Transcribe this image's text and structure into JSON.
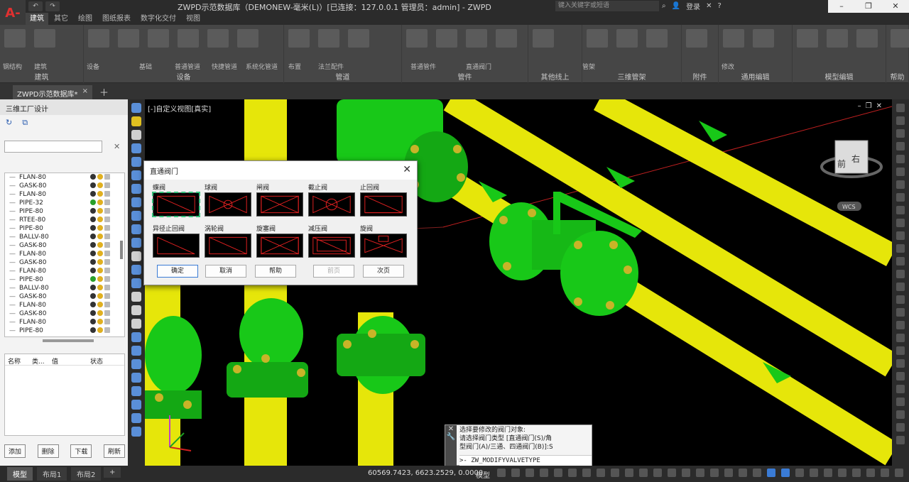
{
  "app": {
    "title": "ZWPD示范数据库（DEMONEW-毫米(L)）[已连接：127.0.0.1 管理员：admin] - ZWPD",
    "logo": "A-",
    "search_placeholder": "键入关键字或短语",
    "login": "登录"
  },
  "ribbon_tabs": [
    "建筑",
    "其它",
    "绘图",
    "图纸报表",
    "数字化交付",
    "视图"
  ],
  "ribbon_tab_active": 0,
  "ribbon_groups": [
    "建筑",
    "设备",
    "管道",
    "管件",
    "其他线上",
    "三维管架",
    "附件",
    "通用编辑",
    "模型编辑",
    "帮助"
  ],
  "ribbon_buttons": [
    "钢结构",
    "建筑",
    "设备",
    "基础",
    "普通管道",
    "快捷管道",
    "系统化管道",
    "布置",
    "法兰配件",
    "普通管件",
    "直通阀门",
    "管架",
    "修改"
  ],
  "document": {
    "tab_label": "ZWPD示范数据库*"
  },
  "left_panel": {
    "title": "三维工厂设计",
    "tree_items": [
      "FLAN-80",
      "GASK-80",
      "FLAN-80",
      "PIPE-32",
      "PIPE-80",
      "RTEE-80",
      "PIPE-80",
      "BALLV-80",
      "GASK-80",
      "FLAN-80",
      "GASK-80",
      "FLAN-80",
      "PIPE-80",
      "BALLV-80",
      "GASK-80",
      "FLAN-80",
      "GASK-80",
      "FLAN-80",
      "PIPE-80"
    ],
    "props_headers": [
      "名称",
      "类...",
      "值",
      "状态"
    ],
    "buttons": [
      "添加",
      "删除",
      "下载",
      "刷新"
    ]
  },
  "viewport": {
    "label": "[-]自定义视图[真实]",
    "cube_face": "右",
    "cube_face2": "前",
    "wcs": "WCS"
  },
  "dialog": {
    "title": "直通阀门",
    "valves": [
      {
        "label": "蝶阀",
        "selected": true
      },
      {
        "label": "球阀",
        "selected": false
      },
      {
        "label": "闸阀",
        "selected": false
      },
      {
        "label": "截止阀",
        "selected": false
      },
      {
        "label": "止回阀",
        "selected": false
      },
      {
        "label": "异径止回阀",
        "selected": false
      },
      {
        "label": "涡轮阀",
        "selected": false
      },
      {
        "label": "旋塞阀",
        "selected": false
      },
      {
        "label": "减压阀",
        "selected": false
      },
      {
        "label": "旋阀",
        "selected": false
      }
    ],
    "buttons": {
      "ok": "确定",
      "cancel": "取消",
      "help": "帮助",
      "prev": "前页",
      "next": "次页"
    }
  },
  "command": {
    "lines": [
      "选择要修改的阀门对象:",
      "请选择阀门类型 [直通阀门(S)/角",
      "型阀门(A)/三通、四通阀门(B)]:S"
    ],
    "input": "ZW_MODIFYVALVETYPE"
  },
  "status": {
    "tabs": [
      "模型",
      "布局1",
      "布局2"
    ],
    "coords": "60569.7423, 6623.2529, 0.0000",
    "model_label": "模型"
  },
  "colors": {
    "pipe_yellow": "#e6e60a",
    "valve_green": "#18c818",
    "bolt_gold": "#c8b428"
  }
}
